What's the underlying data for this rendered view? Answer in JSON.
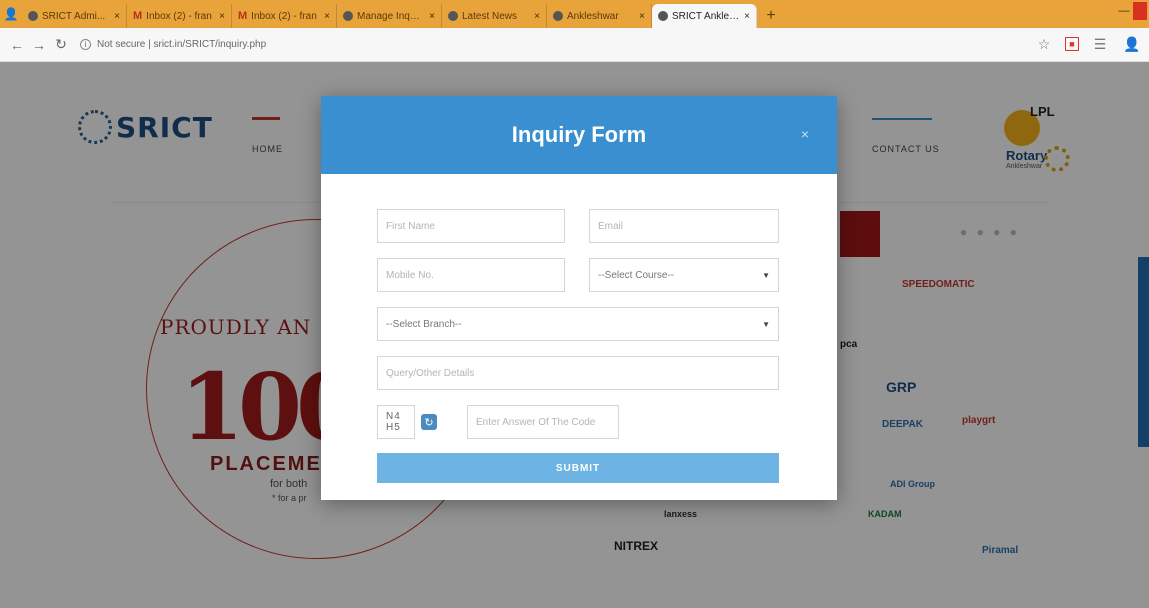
{
  "browser": {
    "tabs": [
      {
        "label": "SRICT Admi...",
        "active": false,
        "favicon": "globe-icon"
      },
      {
        "label": "Inbox (2) - fran",
        "active": false,
        "favicon": "gmail-icon"
      },
      {
        "label": "Inbox (2) - fran",
        "active": false,
        "favicon": "gmail-icon"
      },
      {
        "label": "Manage Inquiries",
        "active": false,
        "favicon": "globe-icon"
      },
      {
        "label": "Latest News",
        "active": false,
        "favicon": "globe-icon"
      },
      {
        "label": "Ankleshwar",
        "active": false,
        "favicon": "globe-icon"
      },
      {
        "label": "SRICT Ankleshwar",
        "active": true,
        "favicon": "globe-icon"
      }
    ],
    "new_tab": "+",
    "address": "Not secure | srict.in/SRICT/inquiry.php"
  },
  "site": {
    "logo_text": "SRICT",
    "nav_home": "HOME",
    "nav_contact": "CONTACT US",
    "lpl_label": "LPL",
    "rotary_label": "Rotary",
    "rotary_sub": "Ankleshwar",
    "banner": {
      "proudly": "PROUDLY AN",
      "big": "100",
      "placement": "PLACEME",
      "line1": "for both",
      "line2": "* for a pr"
    },
    "logos": {
      "l1": "SPEEDOMATIC",
      "l2": "GRP",
      "l3": "DEEPAK",
      "l4": "playgrt",
      "l5": "ADI Group",
      "l6": "KADAM",
      "l7": "NITREX",
      "l8": "Piramal",
      "l9": "lanxess",
      "l10": "pca"
    }
  },
  "modal": {
    "title": "Inquiry Form",
    "close": "×",
    "fields": {
      "first_name": "First Name",
      "email": "Email",
      "mobile": "Mobile No.",
      "course": "--Select Course--",
      "branch": "--Select Branch--",
      "query": "Query/Other Details",
      "captcha_code": "N4 H5",
      "captcha_input": "Enter Answer Of The Code"
    },
    "submit": "SUBMIT"
  },
  "colors": {
    "header_blue": "#3a8fd0",
    "submit_blue": "#6db3e3",
    "chrome_orange": "#e8a33a"
  }
}
